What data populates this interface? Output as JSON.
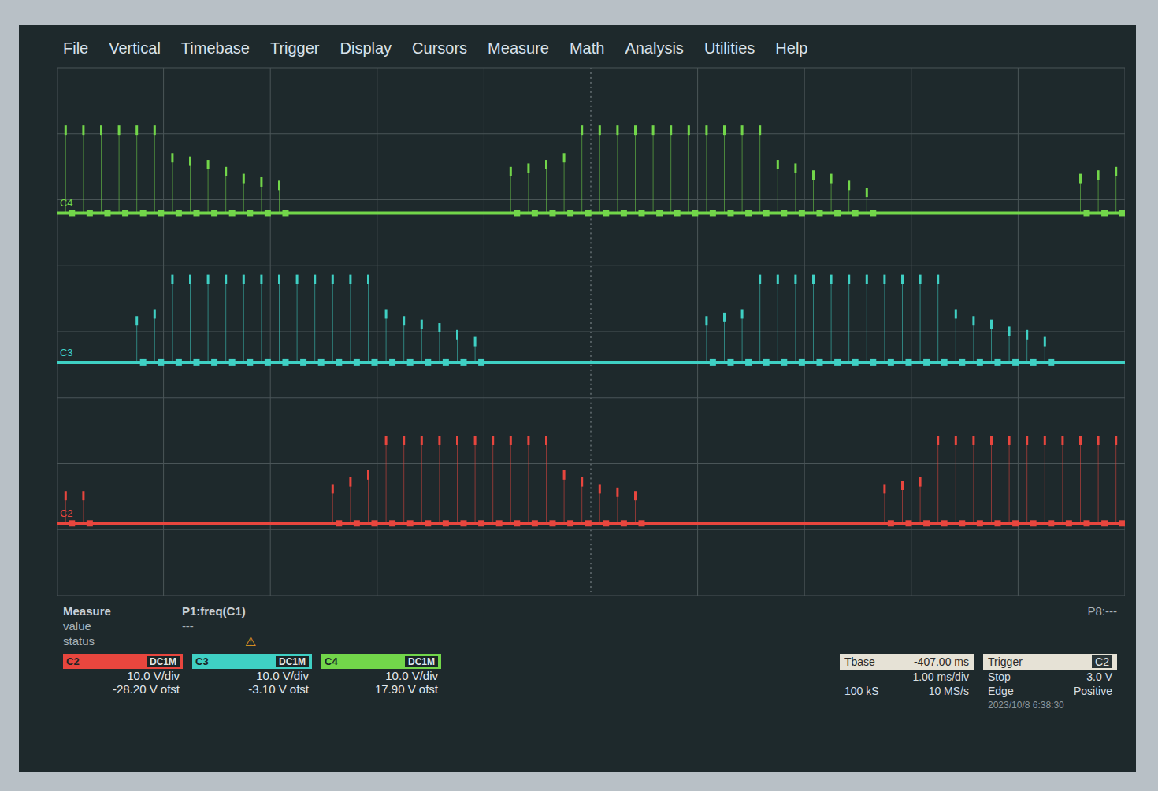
{
  "menu": [
    "File",
    "Vertical",
    "Timebase",
    "Trigger",
    "Display",
    "Cursors",
    "Measure",
    "Math",
    "Analysis",
    "Utilities",
    "Help"
  ],
  "chart": {
    "series": [
      {
        "name": "C4",
        "color": "#72d64a",
        "values": [
          12,
          12,
          12,
          12,
          12,
          12,
          8,
          7.5,
          7,
          6,
          5,
          4.5,
          4,
          0,
          0,
          0,
          0,
          0,
          0,
          0,
          0,
          0,
          0,
          0,
          0,
          6,
          6.5,
          7,
          8,
          12,
          12,
          12,
          12,
          12,
          12,
          12,
          12,
          12,
          12,
          12,
          7,
          6.5,
          5.5,
          5,
          4,
          3,
          0,
          0,
          0,
          0,
          0,
          0,
          0,
          0,
          0,
          0,
          0,
          5,
          5.5,
          6
        ]
      },
      {
        "name": "C3",
        "color": "#3fd0c4",
        "values": [
          0,
          0,
          0,
          0,
          6,
          7,
          12,
          12,
          12,
          12,
          12,
          12,
          12,
          12,
          12,
          12,
          12,
          12,
          7,
          6,
          5.5,
          5,
          4,
          3,
          0,
          0,
          0,
          0,
          0,
          0,
          0,
          0,
          0,
          0,
          0,
          0,
          6,
          6.5,
          7,
          12,
          12,
          12,
          12,
          12,
          12,
          12,
          12,
          12,
          12,
          12,
          7,
          6,
          5.5,
          4.5,
          4,
          3,
          0,
          0,
          0,
          0
        ]
      },
      {
        "name": "C2",
        "color": "#e8463e",
        "values": [
          4,
          4,
          0,
          0,
          0,
          0,
          0,
          0,
          0,
          0,
          0,
          0,
          0,
          0,
          0,
          5,
          6,
          7,
          12,
          12,
          12,
          12,
          12,
          12,
          12,
          12,
          12,
          12,
          7,
          6,
          5,
          4.5,
          4,
          0,
          0,
          0,
          0,
          0,
          0,
          0,
          0,
          0,
          0,
          0,
          0,
          0,
          5,
          5.5,
          6,
          12,
          12,
          12,
          12,
          12,
          12,
          12,
          12,
          12,
          12,
          12
        ]
      }
    ]
  },
  "measure": {
    "title": "Measure",
    "rows": [
      "value",
      "status"
    ],
    "param": {
      "label": "P1:freq(C1)",
      "value": "---",
      "status": "⚠"
    },
    "extra": "P8:---"
  },
  "channels": [
    {
      "label": "C2",
      "coupling": "DC1M",
      "scale": "10.0 V/div",
      "offset": "-28.20 V ofst",
      "color": "#e8463e"
    },
    {
      "label": "C3",
      "coupling": "DC1M",
      "scale": "10.0 V/div",
      "offset": "-3.10 V ofst",
      "color": "#3fd0c4"
    },
    {
      "label": "C4",
      "coupling": "DC1M",
      "scale": "10.0 V/div",
      "offset": "17.90 V ofst",
      "color": "#72d64a"
    }
  ],
  "timebase": {
    "title": "Tbase",
    "delay": "-407.00 ms",
    "scale": "1.00 ms/div",
    "samples": "100 kS",
    "rate": "10 MS/s"
  },
  "trigger": {
    "title": "Trigger",
    "source": "C2",
    "mode": "Stop",
    "level": "3.0 V",
    "type": "Edge",
    "slope": "Positive"
  },
  "timestamp": "2023/10/8 6:38:30"
}
